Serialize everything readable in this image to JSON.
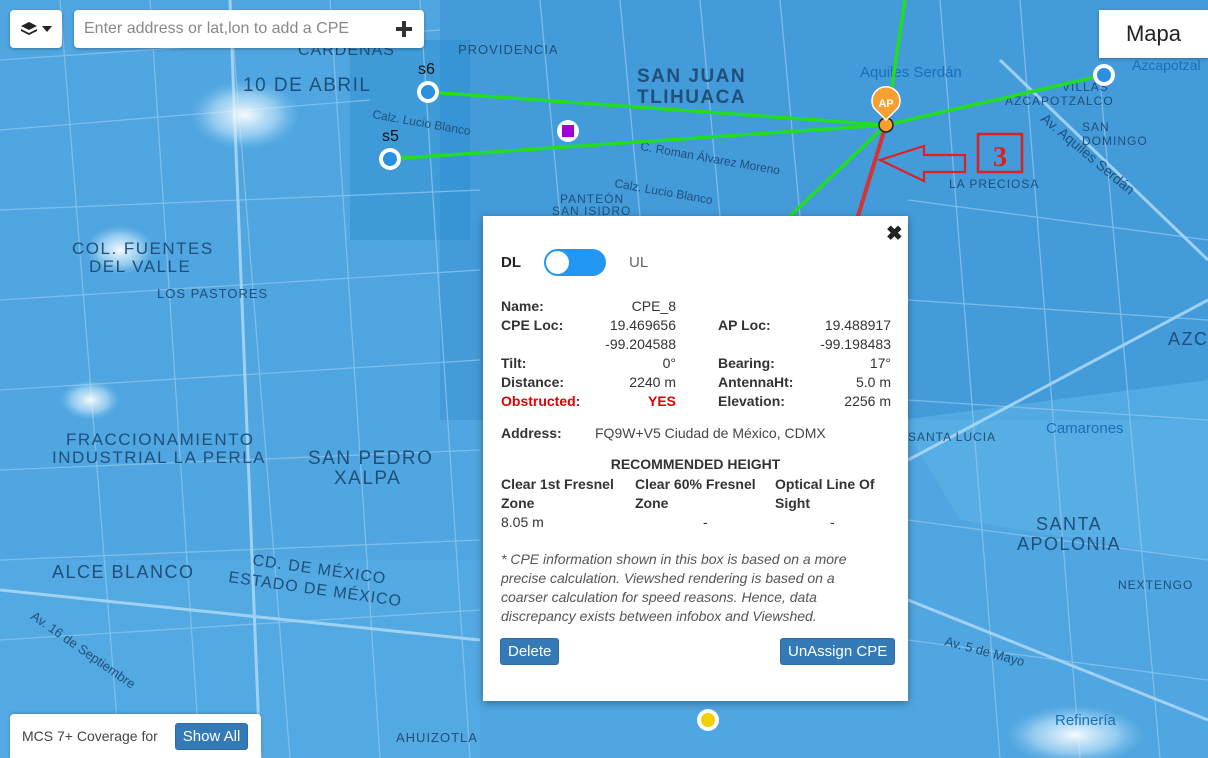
{
  "toolbar": {
    "layers_icon": "layers-icon",
    "search_placeholder": "Enter address or lat,lon to add a CPE",
    "add_icon": "plus-icon",
    "map_type": "Mapa"
  },
  "map": {
    "labels": [
      {
        "text": "CARDENAS"
      },
      {
        "text": "PROVIDENCIA"
      },
      {
        "text": "SAN JUAN"
      },
      {
        "text": "TLIHUACA"
      },
      {
        "text": "10 DE ABRIL"
      },
      {
        "text": "Aquiles Serdán"
      },
      {
        "text": "Azcapotzal"
      },
      {
        "text": "VILLAS"
      },
      {
        "text": "AZCAPOTZALCO"
      },
      {
        "text": "SAN"
      },
      {
        "text": "DOMINGO"
      },
      {
        "text": "LA PRECIOSA"
      },
      {
        "text": "COL. FUENTES"
      },
      {
        "text": "DEL VALLE"
      },
      {
        "text": "LOS PASTORES"
      },
      {
        "text": "FRACCIONAMIENTO"
      },
      {
        "text": "INDUSTRIAL LA PERLA"
      },
      {
        "text": "SAN PEDRO"
      },
      {
        "text": "XALPA"
      },
      {
        "text": "ALCE BLANCO"
      },
      {
        "text": "CD. DE MÉXICO"
      },
      {
        "text": "ESTADO DE MÉXICO"
      },
      {
        "text": "SANTA"
      },
      {
        "text": "APOLONIA"
      },
      {
        "text": "Camarones"
      },
      {
        "text": "Refinería"
      },
      {
        "text": "AHUIZOTLA"
      },
      {
        "text": "PANTEÓN"
      },
      {
        "text": "SAN ISIDRO"
      },
      {
        "text": "SANTA LUCIA"
      },
      {
        "text": "NEXTENGO"
      },
      {
        "text": "AZC"
      },
      {
        "text": "Calz. Lucio Blanco"
      },
      {
        "text": "C. Roman Álvarez Moreno"
      },
      {
        "text": "Calz. Lucio Blanco"
      },
      {
        "text": "Av. Aquiles Serdán"
      },
      {
        "text": "Av. 5 de Mayo"
      },
      {
        "text": "Av. 16 de Septiembre"
      }
    ],
    "sites": [
      {
        "name": "s6"
      },
      {
        "name": "s5"
      }
    ],
    "ap_label": "AP",
    "annotation_number": "3"
  },
  "infobox": {
    "close_label": "✖",
    "toggle": {
      "left": "DL",
      "right": "UL",
      "state": "DL"
    },
    "name_label": "Name:",
    "name_value": "CPE_8",
    "cpe_loc_label": "CPE Loc:",
    "cpe_lat": "19.469656",
    "cpe_lon": "-99.204588",
    "ap_loc_label": "AP Loc:",
    "ap_lat": "19.488917",
    "ap_lon": "-99.198483",
    "tilt_label": "Tilt:",
    "tilt_value": "0°",
    "bearing_label": "Bearing:",
    "bearing_value": "17°",
    "distance_label": "Distance:",
    "distance_value": "2240 m",
    "antenna_label": "AntennaHt:",
    "antenna_value": "5.0 m",
    "obstructed_label": "Obstructed:",
    "obstructed_value": "YES",
    "elevation_label": "Elevation:",
    "elevation_value": "2256 m",
    "address_label": "Address:",
    "address_value": "FQ9W+V5 Ciudad de México, CDMX",
    "recommended_heading": "RECOMMENDED HEIGHT",
    "col1_header": "Clear 1st Fresnel Zone",
    "col2_header": "Clear 60% Fresnel Zone",
    "col3_header": "Optical Line Of Sight",
    "col1_value": "8.05 m",
    "col2_value": "-",
    "col3_value": "-",
    "note": "* CPE information shown in this box is based on a more precise calculation. Viewshed rendering is based on a coarser calculation for speed reasons. Hence, data discrepancy exists between infobox and Viewshed.",
    "delete_label": "Delete",
    "unassign_label": "UnAssign CPE"
  },
  "coverage": {
    "label": "MCS 7+ Coverage for",
    "button": "Show All"
  },
  "colors": {
    "map_water": "#4fa6e0",
    "link_green": "#22dd22",
    "link_red": "#d63333",
    "button_blue": "#337ab7",
    "ap_orange": "#f5a030",
    "cpe_purple": "#a100d8",
    "annotation_red": "#e02020"
  }
}
